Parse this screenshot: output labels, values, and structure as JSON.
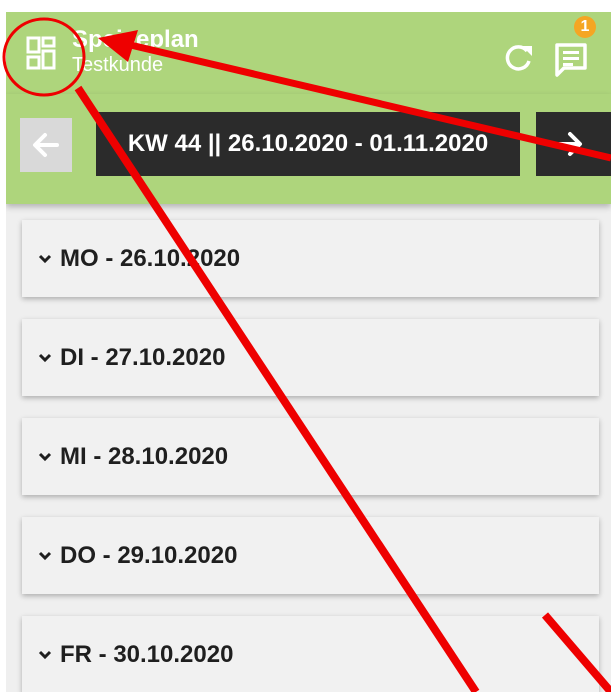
{
  "app": {
    "title": "Speiseplan",
    "subtitle": "Testkunde",
    "notification_count": "1"
  },
  "week_nav": {
    "label": "KW 44 || 26.10.2020 - 01.11.2020"
  },
  "days": [
    {
      "label": "MO - 26.10.2020"
    },
    {
      "label": "DI - 27.10.2020"
    },
    {
      "label": "MI - 28.10.2020"
    },
    {
      "label": "DO - 29.10.2020"
    },
    {
      "label": "FR - 30.10.2020"
    }
  ],
  "colors": {
    "appbar": "#aed57c",
    "nav_button": "#2b2b2b",
    "annotation": "#ee0000",
    "badge": "#f5a623"
  },
  "icons": [
    "dashboard-icon",
    "refresh-icon",
    "message-icon",
    "arrow-left-icon",
    "arrow-right-icon",
    "chevron-down-icon"
  ]
}
